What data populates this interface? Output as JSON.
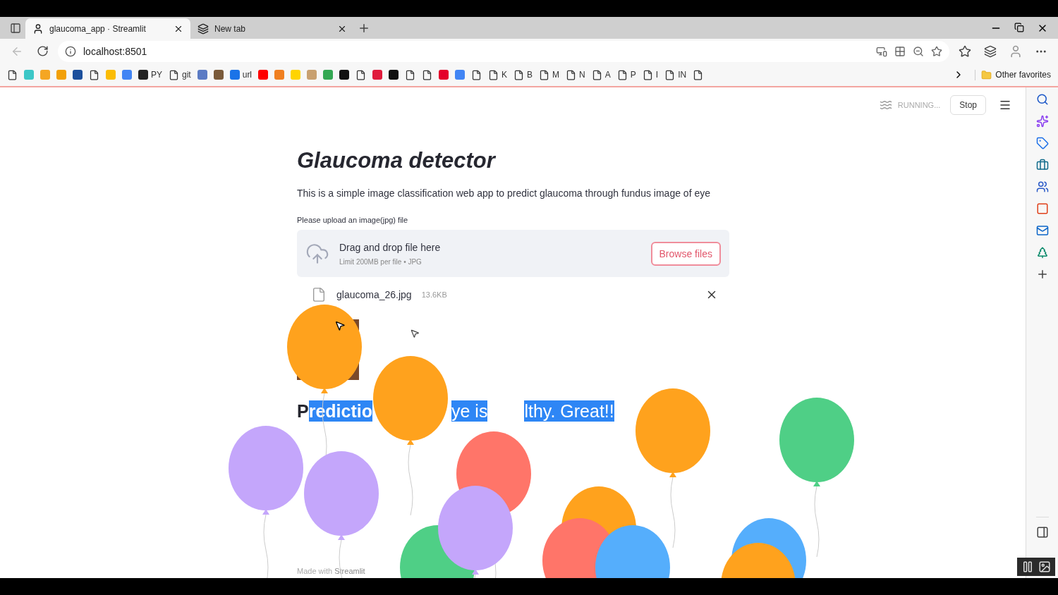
{
  "browser": {
    "tabs": [
      {
        "title": "glaucoma_app · Streamlit",
        "selected": true
      },
      {
        "title": "New tab",
        "selected": false
      }
    ],
    "address": "localhost:8501",
    "bookmarks": [
      {
        "kind": "page"
      },
      {
        "kind": "logo",
        "color": "#3cc7c7"
      },
      {
        "kind": "logo",
        "color": "#f5a623"
      },
      {
        "kind": "logo",
        "color": "#f2a007"
      },
      {
        "kind": "logo",
        "color": "#1b4f9c"
      },
      {
        "kind": "page"
      },
      {
        "kind": "logo",
        "color": "#fbbc04"
      },
      {
        "kind": "logo",
        "color": "#4285f4"
      },
      {
        "kind": "logo",
        "color": "#222222",
        "label": "PY"
      },
      {
        "kind": "page",
        "label": "git"
      },
      {
        "kind": "logo",
        "color": "#5b7bc4"
      },
      {
        "kind": "logo",
        "color": "#7a5a3a"
      },
      {
        "kind": "logo",
        "color": "#1a73e8",
        "label": "url"
      },
      {
        "kind": "logo",
        "color": "#ff0000"
      },
      {
        "kind": "logo",
        "color": "#f08020"
      },
      {
        "kind": "logo",
        "color": "#ffd400"
      },
      {
        "kind": "logo",
        "color": "#c8a070"
      },
      {
        "kind": "logo",
        "color": "#34a853"
      },
      {
        "kind": "logo",
        "color": "#111111"
      },
      {
        "kind": "page"
      },
      {
        "kind": "logo",
        "color": "#e01b3c"
      },
      {
        "kind": "logo",
        "color": "#111111"
      },
      {
        "kind": "page"
      },
      {
        "kind": "page"
      },
      {
        "kind": "logo",
        "color": "#e4002b"
      },
      {
        "kind": "logo",
        "color": "#4285f4"
      },
      {
        "kind": "page"
      },
      {
        "kind": "page",
        "label": "K"
      },
      {
        "kind": "page",
        "label": "B"
      },
      {
        "kind": "page",
        "label": "M"
      },
      {
        "kind": "page",
        "label": "N"
      },
      {
        "kind": "page",
        "label": "A"
      },
      {
        "kind": "page",
        "label": "P"
      },
      {
        "kind": "page",
        "label": "I"
      },
      {
        "kind": "page",
        "label": "IN"
      },
      {
        "kind": "page"
      }
    ],
    "other_favorites": "Other favorites"
  },
  "app": {
    "status": "RUNNING...",
    "stop": "Stop",
    "title": "Glaucoma detector",
    "description": "This is a simple image classification web app to predict glaucoma through fundus image of eye",
    "uploader": {
      "label": "Please upload an image(jpg) file",
      "drop_text": "Drag and drop file here",
      "limit": "Limit 200MB per file • JPG",
      "browse": "Browse files"
    },
    "file": {
      "name": "glaucoma_26.jpg",
      "size": "13.6KB"
    },
    "prediction": [
      {
        "text": "P",
        "bold": true,
        "selected": false
      },
      {
        "text": "redictio",
        "bold": true,
        "selected": true
      },
      {
        "text": "ye is",
        "bold": false,
        "selected": true
      },
      {
        "text": "lthy. Great!!",
        "bold": false,
        "selected": true
      }
    ],
    "footer": "Made with **Streamlit**"
  }
}
